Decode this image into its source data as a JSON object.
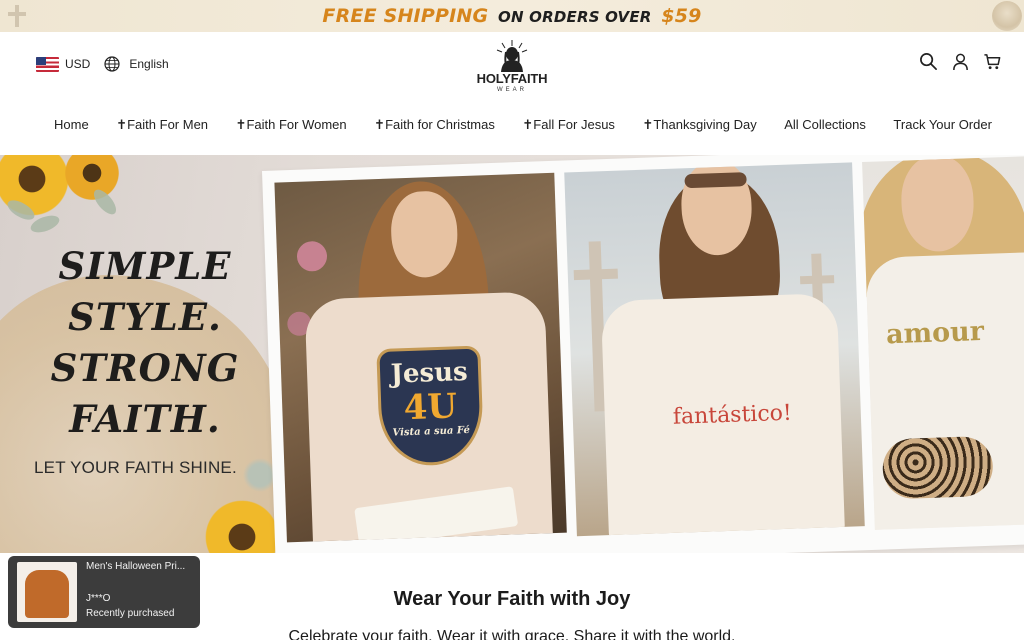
{
  "announcement": {
    "free_shipping": "FREE SHIPPING",
    "on_orders_over": "ON ORDERS OVER",
    "amount": "$59"
  },
  "header": {
    "currency": "USD",
    "language": "English",
    "logo_name": "HOLYFAITH",
    "logo_sub": "WEAR",
    "icons": [
      "search-icon",
      "account-icon",
      "cart-icon"
    ]
  },
  "nav": {
    "items": [
      "Home",
      "✝Faith For Men",
      "✝Faith For Women",
      "✝Faith for Christmas",
      "✝Fall For Jesus",
      "✝Thanksgiving Day",
      "All Collections",
      "Track Your Order"
    ]
  },
  "hero": {
    "headline_lines": [
      "SIMPLE",
      "STYLE.",
      "STRONG",
      "FAITH."
    ],
    "subheadline": "LET YOUR FAITH SHINE.",
    "shirt_1": {
      "line1": "Jesus",
      "line2": "4U",
      "line3": "Vista a sua Fé"
    },
    "shirt_2": "fantástico!",
    "shirt_3": "amour"
  },
  "popup": {
    "product": "Men's Halloween Pri...",
    "buyer": "J***O",
    "status": "Recently purchased"
  },
  "section": {
    "title": "Wear Your Faith with Joy",
    "description": "Celebrate your faith. Wear it with grace. Share it with the world."
  },
  "colors": {
    "announcement_accent": "#d6851c",
    "text": "#1e1e1e",
    "popup_bg": "#3c3c3c"
  }
}
